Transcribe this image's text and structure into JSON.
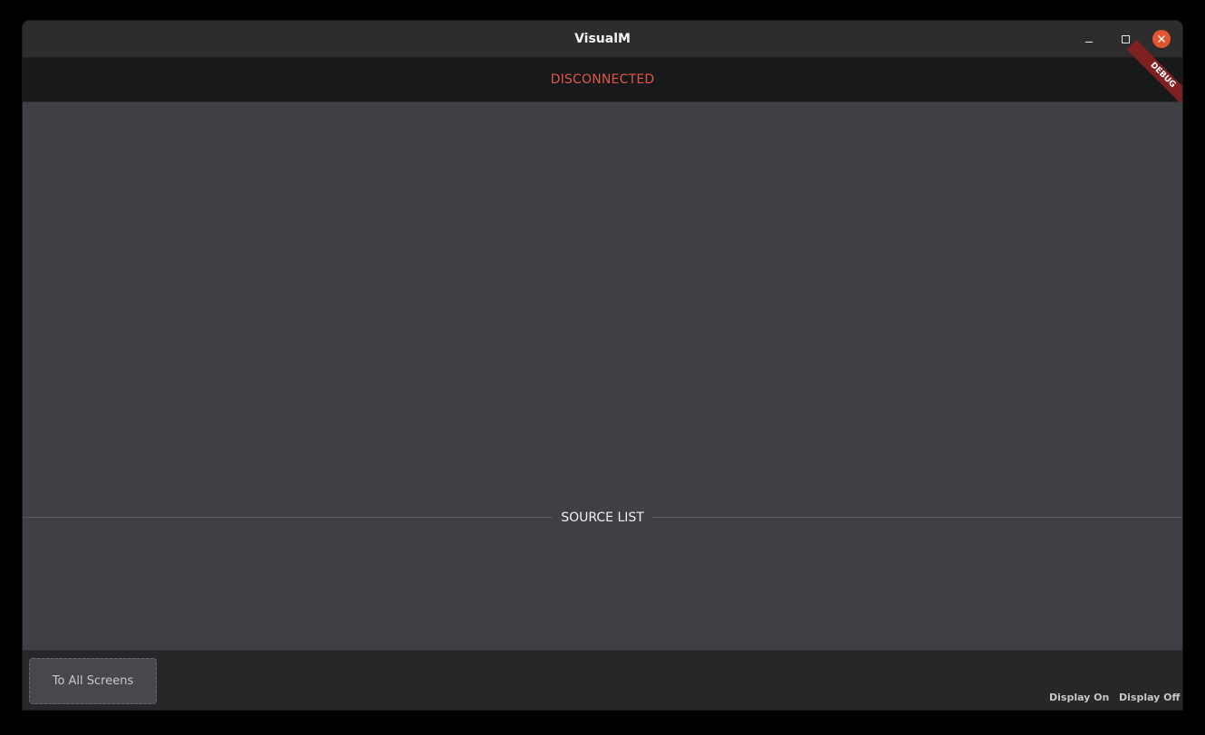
{
  "window": {
    "title": "VisualM"
  },
  "window_controls": {
    "minimize_icon": "minimize-icon",
    "maximize_icon": "maximize-icon",
    "close_icon": "close-icon",
    "close_color": "#e2552f"
  },
  "status": {
    "text": "DISCONNECTED",
    "color": "#e25545",
    "debug_ribbon": "DEBUG"
  },
  "source_list": {
    "label": "SOURCE LIST"
  },
  "bottom_bar": {
    "all_screens_label": "To All Screens",
    "display_on_label": "Display On",
    "display_off_label": "Display Off"
  }
}
